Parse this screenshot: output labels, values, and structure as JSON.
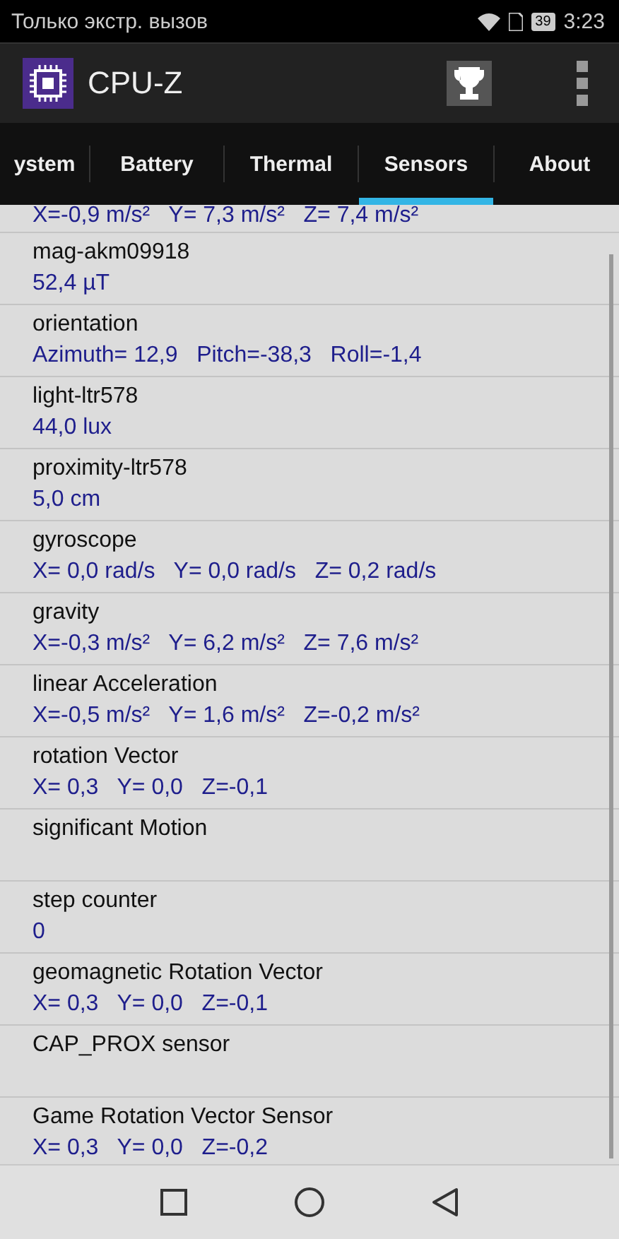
{
  "status_bar": {
    "carrier": "Только экстр. вызов",
    "battery": "39",
    "time": "3:23"
  },
  "app_bar": {
    "title": "CPU-Z"
  },
  "tabs": [
    {
      "label": "ystem",
      "selected": false
    },
    {
      "label": "Battery",
      "selected": false
    },
    {
      "label": "Thermal",
      "selected": false
    },
    {
      "label": "Sensors",
      "selected": true
    },
    {
      "label": "About",
      "selected": false
    }
  ],
  "sensors": [
    {
      "value": "X=-0,9 m/s²   Y= 7,3 m/s²   Z= 7,4 m/s²"
    },
    {
      "name": "mag-akm09918",
      "value": "52,4 µT"
    },
    {
      "name": "orientation",
      "value": "Azimuth= 12,9   Pitch=-38,3   Roll=-1,4"
    },
    {
      "name": "light-ltr578",
      "value": "44,0 lux"
    },
    {
      "name": "proximity-ltr578",
      "value": "5,0 cm"
    },
    {
      "name": "gyroscope",
      "value": "X= 0,0 rad/s   Y= 0,0 rad/s   Z= 0,2 rad/s"
    },
    {
      "name": "gravity",
      "value": "X=-0,3 m/s²   Y= 6,2 m/s²   Z= 7,6 m/s²"
    },
    {
      "name": "linear Acceleration",
      "value": "X=-0,5 m/s²   Y= 1,6 m/s²   Z=-0,2 m/s²"
    },
    {
      "name": "rotation Vector",
      "value": "X= 0,3   Y= 0,0   Z=-0,1"
    },
    {
      "name": "significant Motion"
    },
    {
      "name": "step counter",
      "value": "0"
    },
    {
      "name": "geomagnetic Rotation Vector",
      "value": "X= 0,3   Y= 0,0   Z=-0,1"
    },
    {
      "name": "CAP_PROX sensor"
    },
    {
      "name": "Game Rotation Vector Sensor",
      "value": "X= 0,3   Y= 0,0   Z=-0,2"
    }
  ]
}
